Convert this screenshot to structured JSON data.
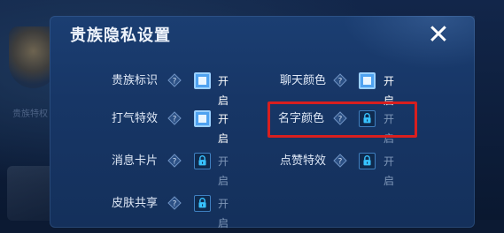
{
  "background": {
    "side_label": "贵族特权"
  },
  "dialog": {
    "title": "贵族隐私设置",
    "close_glyph": "✕"
  },
  "settings": [
    {
      "label": "贵族标识",
      "state": "开启",
      "status": "on"
    },
    {
      "label": "聊天颜色",
      "state": "开启",
      "status": "on"
    },
    {
      "label": "打气特效",
      "state": "开启",
      "status": "on"
    },
    {
      "label": "名字颜色",
      "state": "开启",
      "status": "locked",
      "highlighted": true
    },
    {
      "label": "消息卡片",
      "state": "开启",
      "status": "locked"
    },
    {
      "label": "点赞特效",
      "state": "开启",
      "status": "locked"
    },
    {
      "label": "皮肤共享",
      "state": "开启",
      "status": "locked"
    }
  ],
  "colors": {
    "highlight_border": "#d81f1f",
    "toggle_on": "#4fa2f0",
    "lock_icon": "#38c3ff"
  },
  "icons": {
    "help": "question-diamond-icon",
    "lock": "lock-icon",
    "close": "close-icon"
  }
}
